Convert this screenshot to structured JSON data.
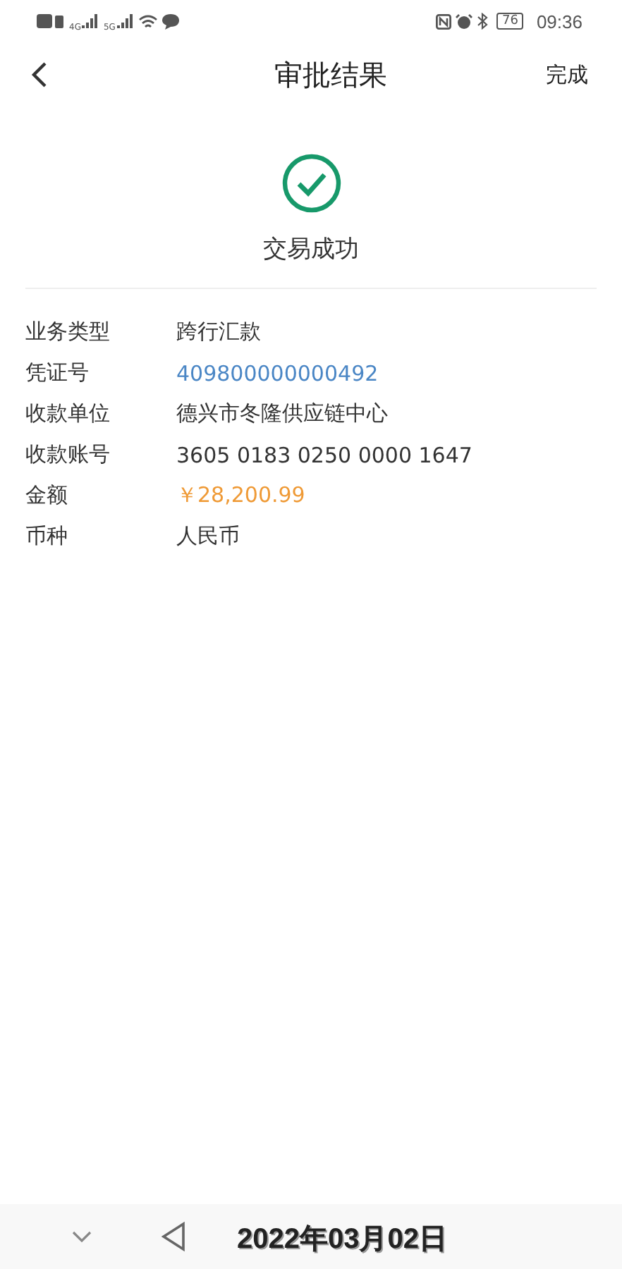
{
  "status_bar": {
    "network_left": "4G",
    "network_right": "5G",
    "battery": "76",
    "time": "09:36"
  },
  "header": {
    "title": "审批结果",
    "action": "完成"
  },
  "result": {
    "message": "交易成功"
  },
  "details": [
    {
      "label": "业务类型",
      "value": "跨行汇款",
      "kind": "plain"
    },
    {
      "label": "凭证号",
      "value": "409800000000492",
      "kind": "link"
    },
    {
      "label": "收款单位",
      "value": "德兴市冬隆供应链中心",
      "kind": "plain"
    },
    {
      "label": "收款账号",
      "value": "3605 0183 0250 0000 1647",
      "kind": "plain"
    },
    {
      "label": "金额",
      "value": "￥28,200.99",
      "kind": "amount"
    },
    {
      "label": "币种",
      "value": "人民币",
      "kind": "plain"
    }
  ],
  "date_stamp": "2022年03月02日"
}
